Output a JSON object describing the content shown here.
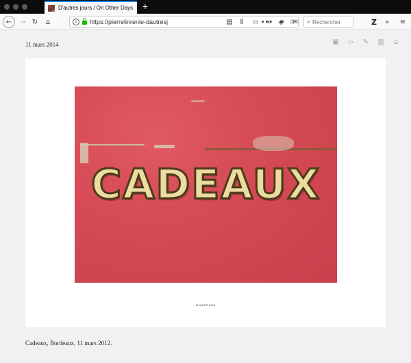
{
  "browser": {
    "tab_title": "D'autres jours / On Other Days",
    "url": "https://pierrelinrenie-dautresj",
    "search_placeholder": "Rechercher",
    "icons": {
      "back": "back-arrow-icon",
      "forward": "forward-arrow-icon",
      "reload": "reload-icon",
      "home": "home-icon",
      "info": "info-icon",
      "lock": "lock-icon",
      "more": "more-icon",
      "pocket": "pocket-icon",
      "bookmark": "star-icon",
      "reader": "reader-view-icon",
      "library": "library-icon",
      "downloads": "downloads-icon",
      "extension_mask": "mask-icon",
      "extension_link": "link-icon",
      "extension_mail": "mail-icon",
      "search": "search-icon",
      "zotero": "zotero-icon",
      "overflow": "overflow-chevrons-icon",
      "menu": "hamburger-menu-icon"
    },
    "extension_label": "Z"
  },
  "page": {
    "date": "11 mars 2014",
    "photo_text": "CADEAUX",
    "photo_small_caption": "11 MARS 2012",
    "caption": "Cadeaux, Bordeaux, 11 mars 2012.",
    "tools": [
      "gallery-icon",
      "code-icon",
      "edit-icon",
      "archive-icon",
      "home-icon"
    ]
  }
}
